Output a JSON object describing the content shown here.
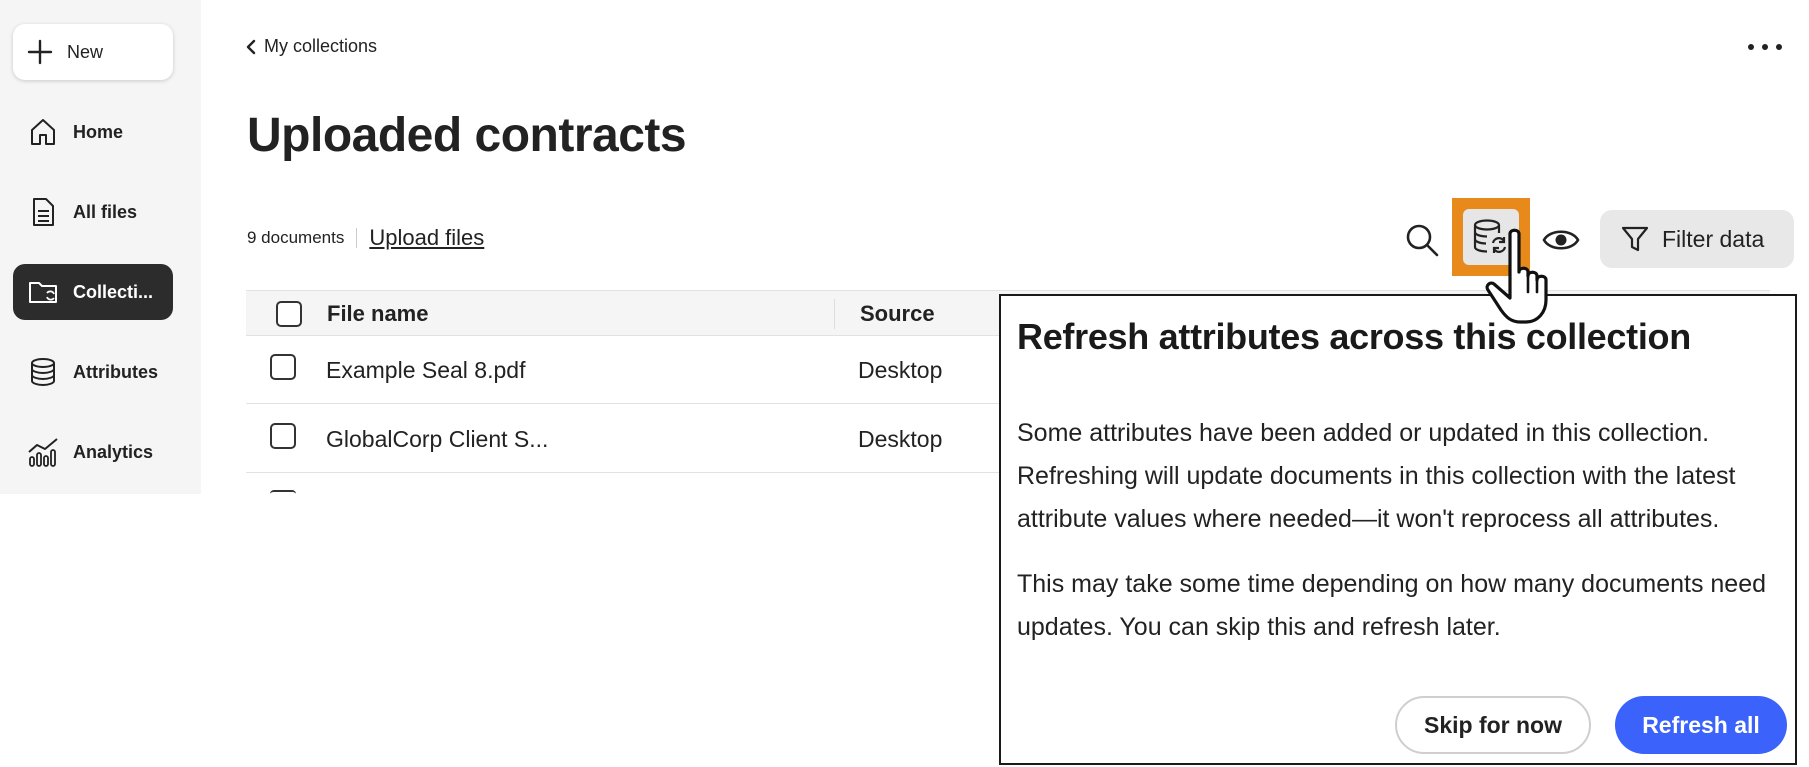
{
  "sidebar": {
    "new_label": "New",
    "items": [
      {
        "label": "Home",
        "icon": "home-icon"
      },
      {
        "label": "All files",
        "icon": "file-icon"
      },
      {
        "label": "Collecti...",
        "icon": "folder-sync-icon",
        "active": true
      },
      {
        "label": "Attributes",
        "icon": "database-icon"
      },
      {
        "label": "Analytics",
        "icon": "analytics-icon"
      }
    ]
  },
  "header": {
    "back_label": "My collections",
    "title": "Uploaded contracts"
  },
  "toolbar": {
    "doc_count": "9 documents",
    "upload_label": "Upload files",
    "filter_label": "Filter data",
    "highlight_color": "#e8891b"
  },
  "table": {
    "columns": [
      "File name",
      "Source"
    ],
    "rows": [
      {
        "name": "Example Seal 8.pdf",
        "source": "Desktop"
      },
      {
        "name": "GlobalCorp Client S...",
        "source": "Desktop"
      }
    ]
  },
  "coach": {
    "title": "Refresh attributes across this collection",
    "p1": "Some attributes have been added or updated in this collection. Refreshing will update documents in this collection with the latest attribute values where needed—it won't reprocess all attributes.",
    "p2": "This may take some time depending on how many documents need updates. You can skip this and refresh later.",
    "skip_label": "Skip for now",
    "refresh_label": "Refresh all",
    "primary_color": "#3b63fb"
  }
}
